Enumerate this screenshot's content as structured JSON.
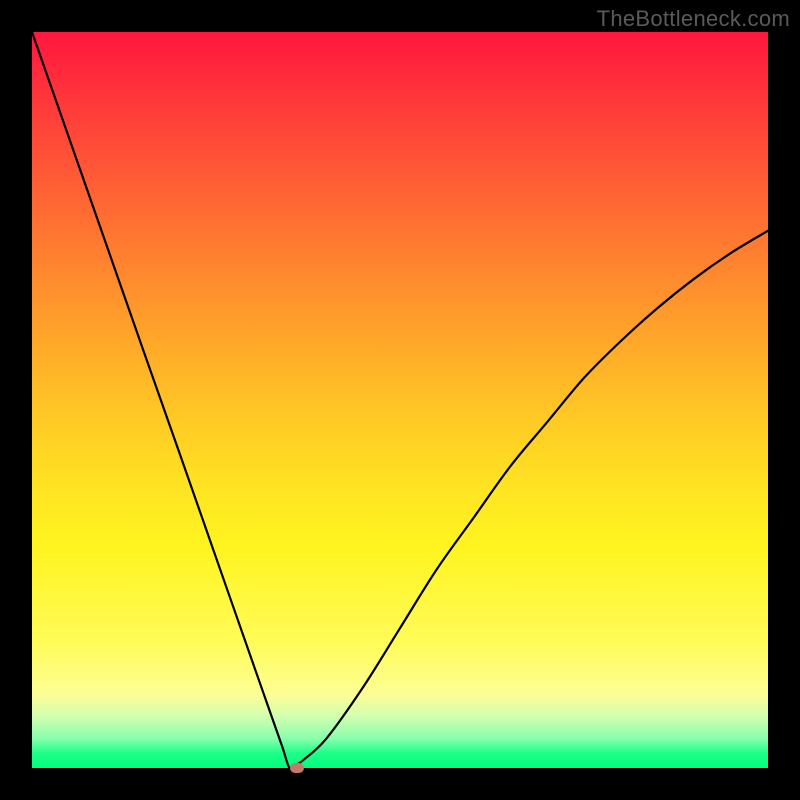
{
  "watermark": "TheBottleneck.com",
  "chart_data": {
    "type": "line",
    "title": "",
    "xlabel": "",
    "ylabel": "",
    "xlim": [
      0,
      100
    ],
    "ylim": [
      0,
      100
    ],
    "x": [
      0,
      5,
      10,
      15,
      20,
      25,
      30,
      32,
      34,
      35,
      36,
      37,
      40,
      45,
      50,
      55,
      60,
      65,
      70,
      75,
      80,
      85,
      90,
      95,
      100
    ],
    "values": [
      100,
      85.7,
      71.4,
      57.1,
      42.9,
      28.6,
      14.3,
      8.6,
      2.9,
      0,
      0.5,
      1.2,
      4,
      11,
      19,
      27,
      34,
      41,
      47,
      53,
      58,
      62.5,
      66.5,
      70,
      73
    ],
    "minimum_point": {
      "x": 35,
      "y": 0
    },
    "marker": {
      "x": 36,
      "y": 0,
      "color": "#c47a6a"
    },
    "background_gradient": {
      "top": "#ff173e",
      "bottom": "#00ff7d"
    }
  }
}
